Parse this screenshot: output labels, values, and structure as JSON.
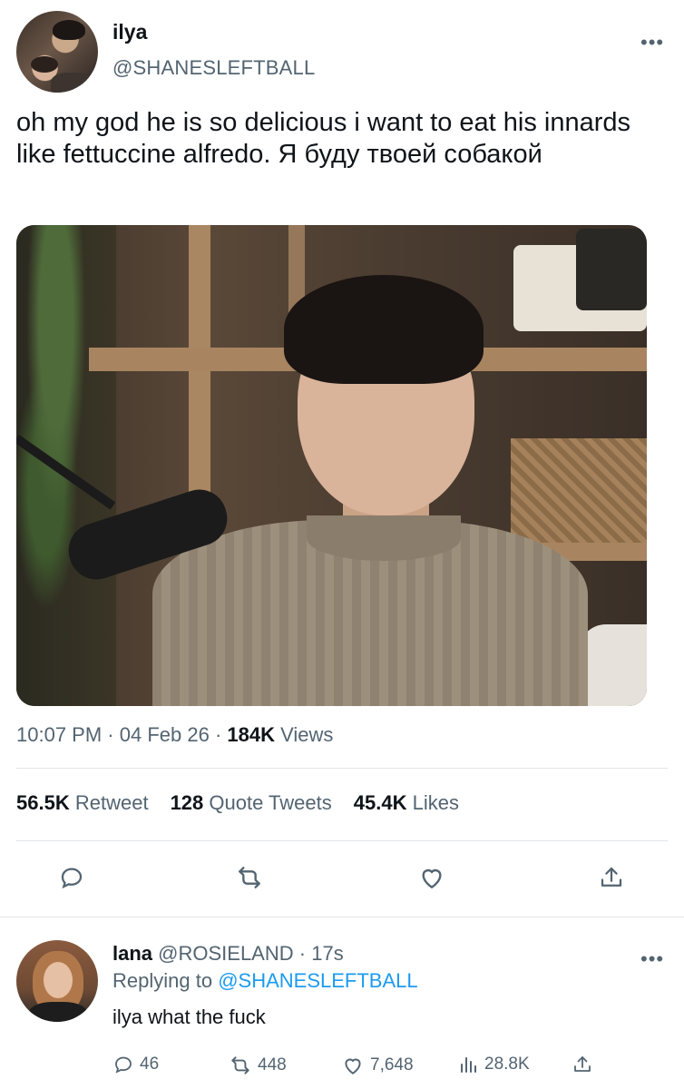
{
  "tweet": {
    "author_name": "ilya",
    "author_handle": "@SHANESLEFTBALL",
    "more": "•••",
    "text": "oh my god he is so delicious i want to eat his innards like fettuccine alfredo. Я буду твоей собакой",
    "time": "10:07 PM",
    "date": "04 Feb 26",
    "views_count": "184K",
    "views_label": "Views",
    "stats": {
      "retweets_count": "56.5K",
      "retweets_label": "Retweet",
      "quotes_count": "128",
      "quotes_label": "Quote Tweets",
      "likes_count": "45.4K",
      "likes_label": "Likes"
    },
    "actions": [
      "reply-icon",
      "retweet-icon",
      "like-icon",
      "share-icon"
    ]
  },
  "reply": {
    "author_name": "lana",
    "author_handle": "@ROSIELAND",
    "time": "17s",
    "more": "•••",
    "replying_prefix": "Replying to",
    "replying_to": "@SHANESLEFTBALL",
    "text": "ilya what the fuck",
    "counts": {
      "replies": "46",
      "retweets": "448",
      "likes": "7,648",
      "views": "28.8K"
    }
  },
  "colors": {
    "text": "#0f1419",
    "muted": "#536471",
    "link": "#1d9bf0",
    "divider": "#e1e5e8"
  }
}
